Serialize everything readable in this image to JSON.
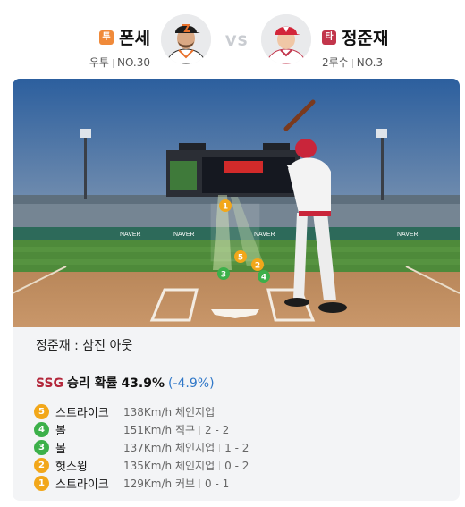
{
  "header": {
    "pitcher": {
      "role_badge": "투",
      "name": "폰세",
      "position": "우투",
      "number": "NO.30",
      "avatar_icon": "player-photo-icon"
    },
    "vs": "VS",
    "batter": {
      "role_badge": "타",
      "name": "정준재",
      "position": "2루수",
      "number": "NO.3",
      "avatar_icon": "player-photo-icon"
    }
  },
  "field_view": {
    "scoreboard_brand": "NAVER",
    "wall_ads": [
      "NAVER",
      "NAVER",
      "NAVER",
      "NAVER"
    ],
    "pitch_markers": [
      {
        "label": "1",
        "type": "strike"
      },
      {
        "label": "2",
        "type": "strike"
      },
      {
        "label": "3",
        "type": "ball"
      },
      {
        "label": "4",
        "type": "ball"
      },
      {
        "label": "5",
        "type": "strike"
      }
    ],
    "colors": {
      "strike": "#f2a71a",
      "ball": "#3cb04a"
    }
  },
  "result": "정준재 : 삼진 아웃",
  "win_probability": {
    "team": "SSG",
    "label": "승리 확률",
    "value": "43.9%",
    "delta": "(-4.9%)"
  },
  "pitches": [
    {
      "num": "5",
      "type": "strike",
      "result": "스트라이크",
      "speed": "138Km/h",
      "pitch": "체인지업",
      "count": ""
    },
    {
      "num": "4",
      "type": "ball",
      "result": "볼",
      "speed": "151Km/h",
      "pitch": "직구",
      "count": "2 - 2"
    },
    {
      "num": "3",
      "type": "ball",
      "result": "볼",
      "speed": "137Km/h",
      "pitch": "체인지업",
      "count": "1 - 2"
    },
    {
      "num": "2",
      "type": "strike",
      "result": "헛스윙",
      "speed": "135Km/h",
      "pitch": "체인지업",
      "count": "0 - 2"
    },
    {
      "num": "1",
      "type": "strike",
      "result": "스트라이크",
      "speed": "129Km/h",
      "pitch": "커브",
      "count": "0 - 1"
    }
  ]
}
